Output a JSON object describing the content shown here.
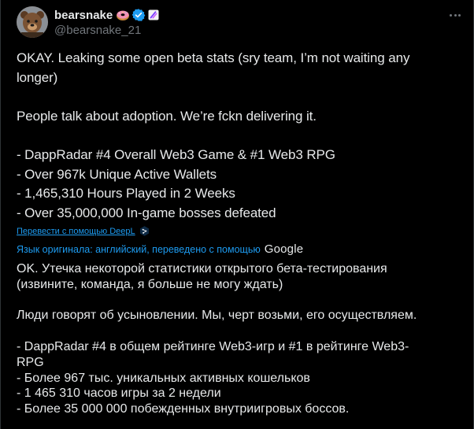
{
  "author": {
    "display_name": "bearsnake",
    "handle": "@bearsnake_21",
    "avatar_icon": "bear-avatar-icon",
    "badges": [
      "donut-emoji-icon",
      "verified-badge-icon",
      "affiliate-badge-icon"
    ]
  },
  "tweet": {
    "text": "OKAY. Leaking some open beta stats (sry team, I’m not waiting any\nlonger)\n\nPeople talk about adoption. We’re fckn delivering it.\n\n- DappRadar #4 Overall Web3 Game & #1 Web3 RPG\n- Over 967k Unique Active Wallets\n- 1,465,310 Hours Played in 2 Weeks\n- Over 35,000,000 In-game bosses defeated"
  },
  "translation": {
    "deepl_link": "Перевести с помощью DeepL",
    "original_language_note": "Язык оригинала: английский, переведено с помощью",
    "google_label": "Google",
    "text": "OK. Утечка некоторой статистики открытого бета-тестирования\n(извините, команда, я больше не могу ждать)\n\nЛюди говорят об усыновлении. Мы, черт возьми, его осуществляем.\n\n- DappRadar #4 в общем рейтинге Web3-игр и #1 в рейтинге Web3-\nRPG\n- Более 967 тыс. уникальных активных кошельков\n- 1 465 310 часов игры за 2 недели\n- Более 35 000 000 побежденных внутриигровых боссов."
  },
  "colors": {
    "background": "#000000",
    "text": "#e7e9ea",
    "secondary": "#71767b",
    "link": "#1d9bf0",
    "verified": "#1d9bf0"
  }
}
